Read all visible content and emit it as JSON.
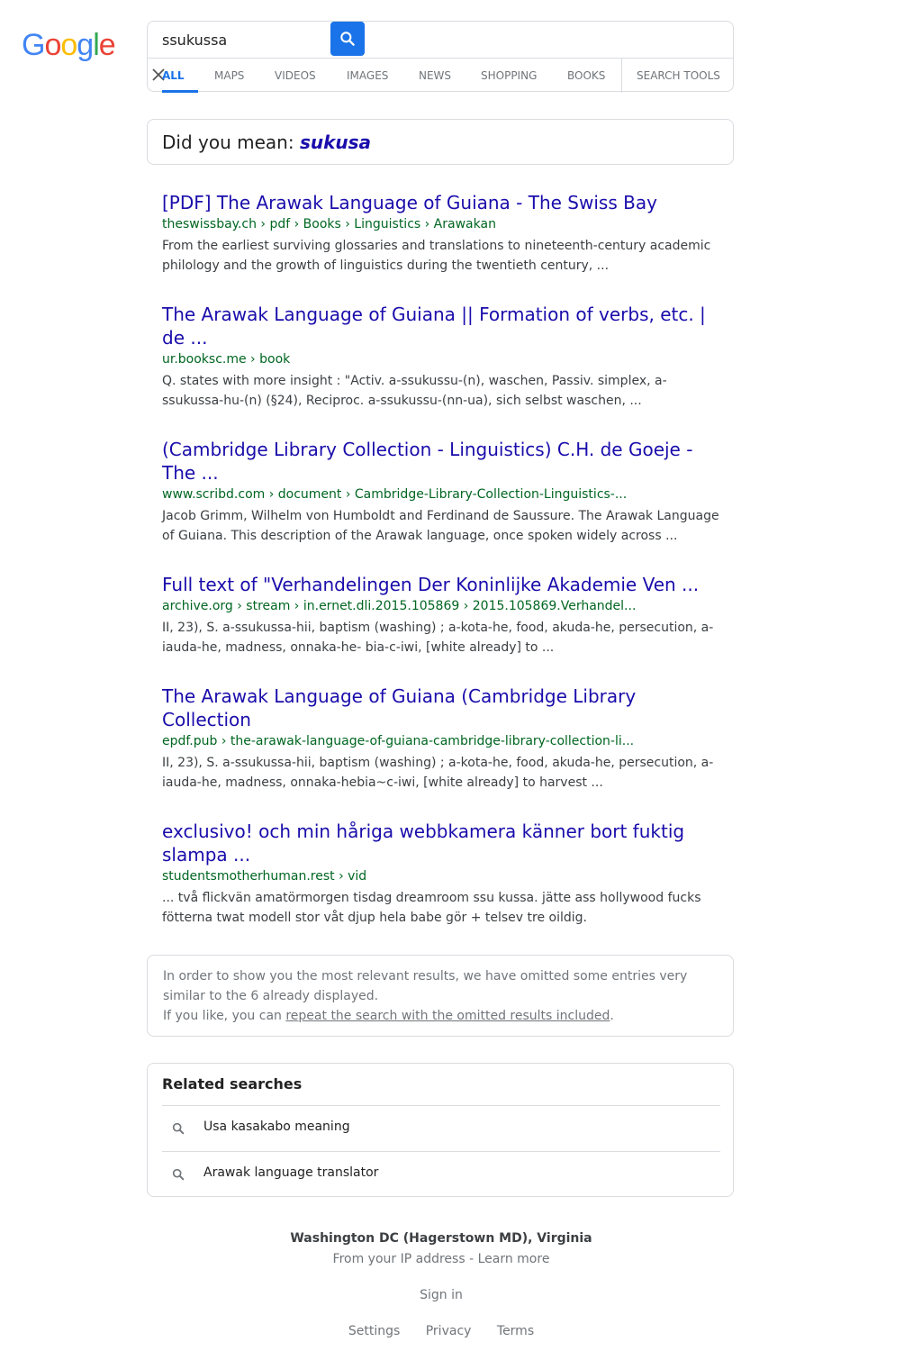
{
  "logo": {
    "letters": [
      [
        "G",
        "#4285f4"
      ],
      [
        "o",
        "#ea4335"
      ],
      [
        "o",
        "#fbbc05"
      ],
      [
        "g",
        "#4285f4"
      ],
      [
        "l",
        "#34a853"
      ],
      [
        "e",
        "#ea4335"
      ]
    ],
    "text": "Google"
  },
  "search": {
    "value": "ssukussa"
  },
  "tabs": [
    "ALL",
    "MAPS",
    "VIDEOS",
    "IMAGES",
    "NEWS",
    "SHOPPING",
    "BOOKS",
    "SEARCH TOOLS"
  ],
  "did_you_mean": {
    "prefix": "Did you mean: ",
    "suggestion": "sukusa"
  },
  "results": [
    {
      "title": "[PDF] The Arawak Language of Guiana - The Swiss Bay",
      "url": "theswissbay.ch › pdf › Books › Linguistics › Arawakan",
      "snippet": "From the earliest surviving glossaries and translations to nineteenth-century academic philology and the growth of linguistics during the twentieth century, ..."
    },
    {
      "title": "The Arawak Language of Guiana || Formation of verbs, etc. | de ...",
      "url": "ur.booksc.me › book",
      "snippet": "Q. states with more insight : \"Activ. a-ssukussu-(n), waschen, Passiv. simplex, a-ssukussa-hu-(n) (§24), Reciproc. a-ssukussu-(nn-ua), sich selbst waschen, ..."
    },
    {
      "title": "(Cambridge Library Collection - Linguistics) C.H. de Goeje - The ...",
      "url": "www.scribd.com › document › Cambridge-Library-Collection-Linguistics-...",
      "snippet": "Jacob Grimm, Wilhelm von Humboldt and Ferdinand de Saussure. The Arawak Language of Guiana. This description of the Arawak language, once spoken widely across ..."
    },
    {
      "title": "Full text of \"Verhandelingen Der Koninlijke Akademie Ven ...",
      "url": "archive.org › stream › in.ernet.dli.2015.105869 › 2015.105869.Verhandel...",
      "snippet": "II, 23), S. a-ssukussa-hii, baptism (washing) ; a-kota-he, food, akuda-he, persecution, a-iauda-he, madness, onnaka-he- bia-c-iwi, [white already] to ..."
    },
    {
      "title": "The Arawak Language of Guiana (Cambridge Library Collection",
      "url": "epdf.pub › the-arawak-language-of-guiana-cambridge-library-collection-li...",
      "snippet": "II, 23), S. a-ssukussa-hii, baptism (washing) ; a-kota-he, food, akuda-he, persecution, a-iauda-he, madness, onnaka-hebia~c-iwi, [white already] to harvest ..."
    },
    {
      "title": "exclusivo! och min håriga webbkamera känner bort fuktig slampa ...",
      "url": "studentsmotherhuman.rest › vid",
      "snippet": "... två flickvän amatörmorgen tisdag dreamroom ssu kussa. jätte ass hollywood fucks fötterna twat modell stor våt djup hela babe gör + telsev tre oildig."
    }
  ],
  "omitted": {
    "line1": "In order to show you the most relevant results, we have omitted some entries very similar to the 6 already displayed.",
    "line2_prefix": "If you like, you can ",
    "line2_link": "repeat the search with the omitted results included",
    "line2_suffix": "."
  },
  "related": {
    "title": "Related searches",
    "items": [
      "Usa kasakabo meaning",
      "Arawak language translator"
    ]
  },
  "footer": {
    "location": "Washington DC (Hagerstown MD), Virginia",
    "ip_line": "From your IP address - Learn more",
    "signin": "Sign in",
    "links": [
      "Settings",
      "Privacy",
      "Terms"
    ]
  }
}
